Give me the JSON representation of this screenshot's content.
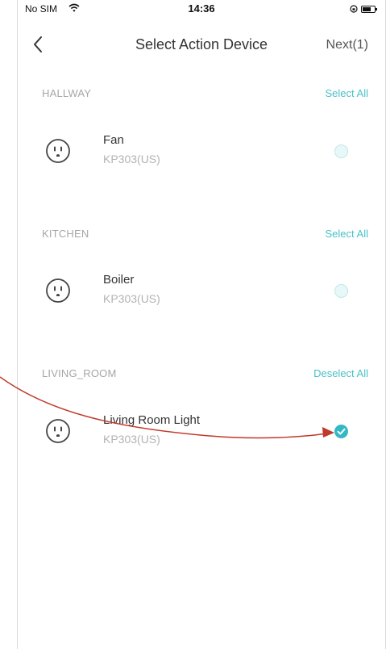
{
  "status_bar": {
    "carrier": "No SIM",
    "time": "14:36"
  },
  "nav": {
    "title": "Select Action Device",
    "next_label": "Next(1)"
  },
  "rooms": [
    {
      "name": "HALLWAY",
      "action": "Select All",
      "devices": [
        {
          "name": "Fan",
          "model": "KP303(US)",
          "selected": false
        }
      ]
    },
    {
      "name": "KITCHEN",
      "action": "Select All",
      "devices": [
        {
          "name": "Boiler",
          "model": "KP303(US)",
          "selected": false
        }
      ]
    },
    {
      "name": "LIVING_ROOM",
      "action": "Deselect All",
      "devices": [
        {
          "name": "Living Room Light",
          "model": "KP303(US)",
          "selected": true
        }
      ]
    }
  ],
  "colors": {
    "accent": "#49c1c8",
    "annotation_arrow": "#c0392b"
  }
}
